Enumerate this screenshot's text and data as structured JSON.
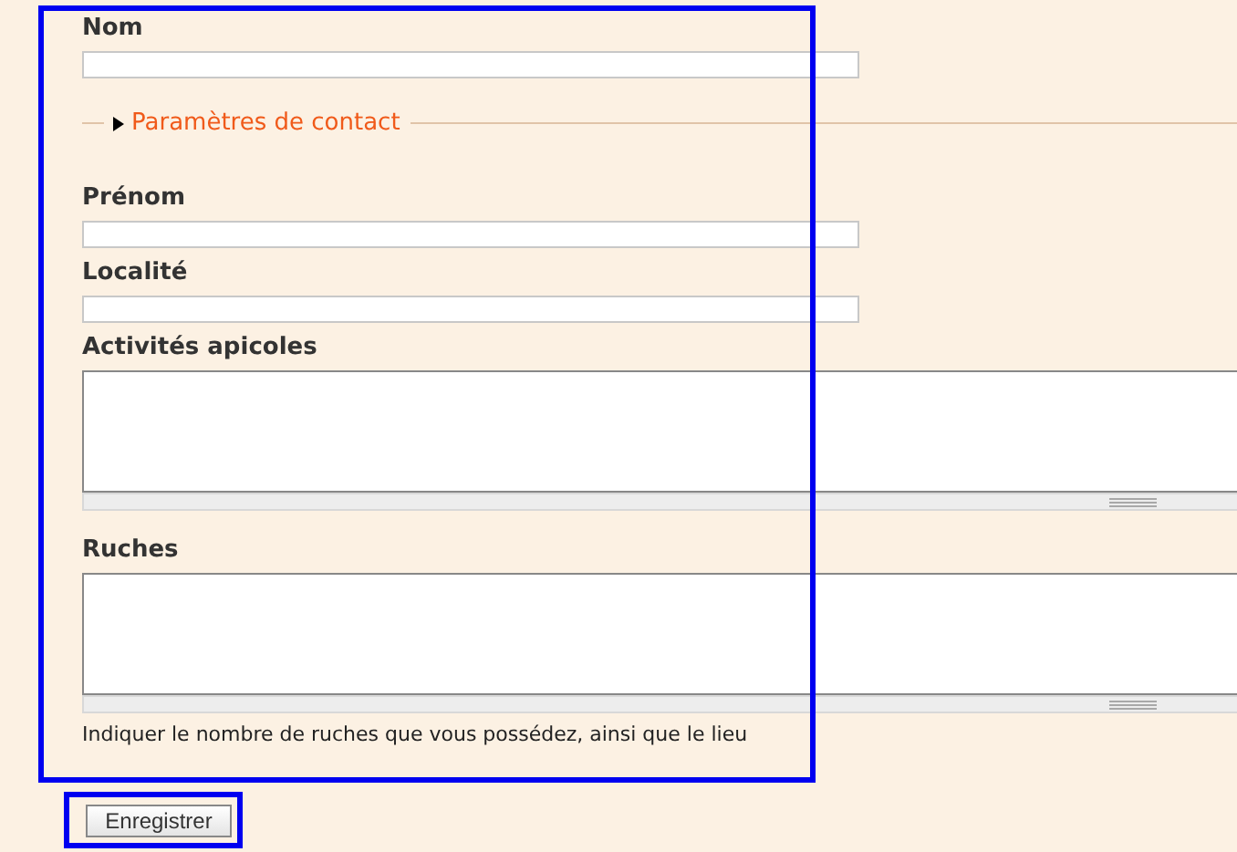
{
  "form": {
    "items": [
      {
        "kind": "input",
        "label": "Nom"
      },
      {
        "kind": "section",
        "label": "Paramètres de contact",
        "expanded": false
      },
      {
        "kind": "input",
        "label": "Prénom"
      },
      {
        "kind": "input",
        "label": "Localité"
      },
      {
        "kind": "textarea",
        "label": "Activités apicoles"
      },
      {
        "kind": "textarea",
        "label": "Ruches",
        "hint": "Indiquer le nombre de ruches que vous possédez, ainsi que le lieu"
      }
    ]
  },
  "submit": {
    "label": "Enregistrer"
  }
}
